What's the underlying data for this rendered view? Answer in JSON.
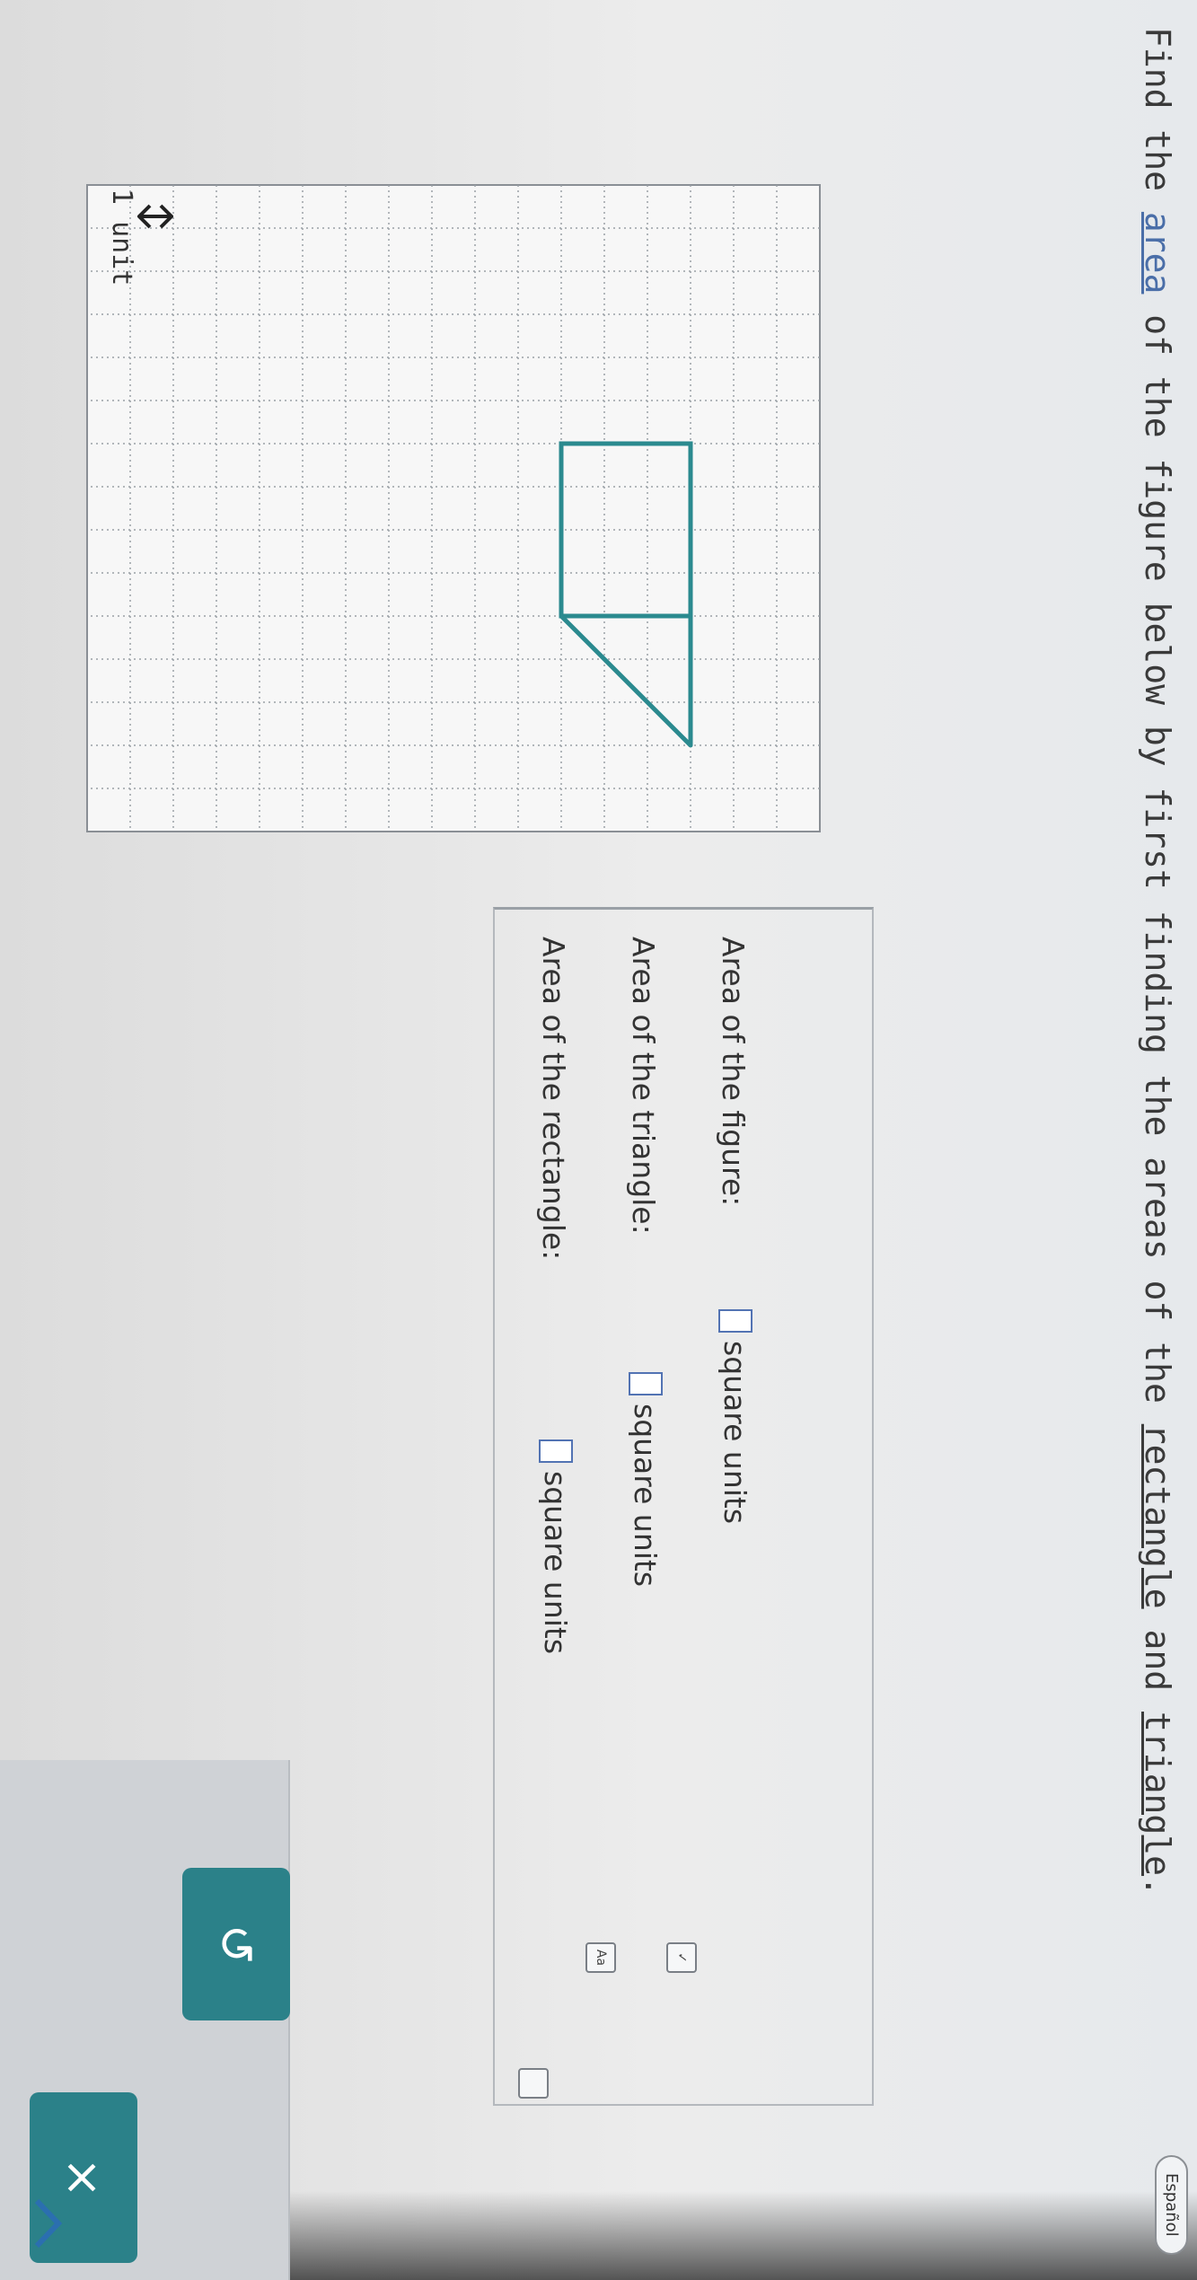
{
  "header": {
    "language_toggle": "Español"
  },
  "question": {
    "prefix": "Find the ",
    "term_area": "area",
    "middle": " of the figure below by first finding the areas of the ",
    "term_rectangle": "rectangle",
    "and": " and ",
    "term_triangle": "triangle",
    "suffix": "."
  },
  "grid": {
    "unit_label": "1 unit",
    "columns": 15,
    "rows": 17,
    "figure": {
      "rectangle": {
        "width_units": 3,
        "height_units": 4
      },
      "triangle": {
        "base_units": 3,
        "height_units": 3
      }
    }
  },
  "answers": {
    "rectangle_label": "Area of the rectangle:",
    "triangle_label": "Area of the triangle:",
    "figure_label": "Area of the figure:",
    "units": "square units",
    "rectangle_value": "",
    "triangle_value": "",
    "figure_value": ""
  },
  "tools": {
    "aa_label": "Aa",
    "check_label": "✓"
  },
  "buttons": {
    "undo_icon": "↺",
    "clear_icon": "×"
  },
  "colors": {
    "figure_stroke": "#2b8a8f",
    "button_bg": "#2b8189",
    "answer_box_border": "#5273b3"
  }
}
